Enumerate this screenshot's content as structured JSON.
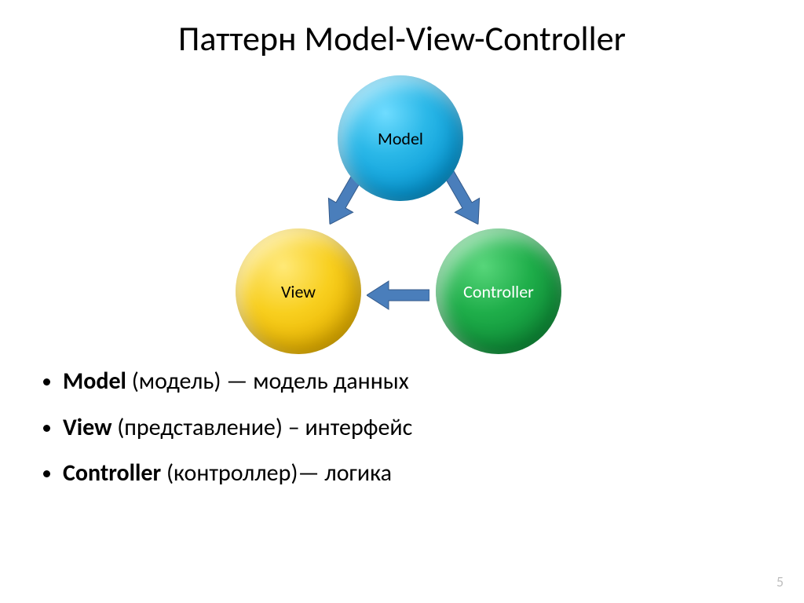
{
  "title": "Паттерн Model-View-Controller",
  "nodes": {
    "model": "Model",
    "view": "View",
    "controller": "Controller"
  },
  "bullets": [
    {
      "term": "Model",
      "translit": " (модель) ",
      "dash": "— ",
      "def": "модель данных"
    },
    {
      "term": "View",
      "translit": " (представление) ",
      "dash": "– ",
      "def": "интерфейс"
    },
    {
      "term": "Controller",
      "translit": " (контроллер)",
      "dash": "— ",
      "def": "логика"
    }
  ],
  "page": "5"
}
